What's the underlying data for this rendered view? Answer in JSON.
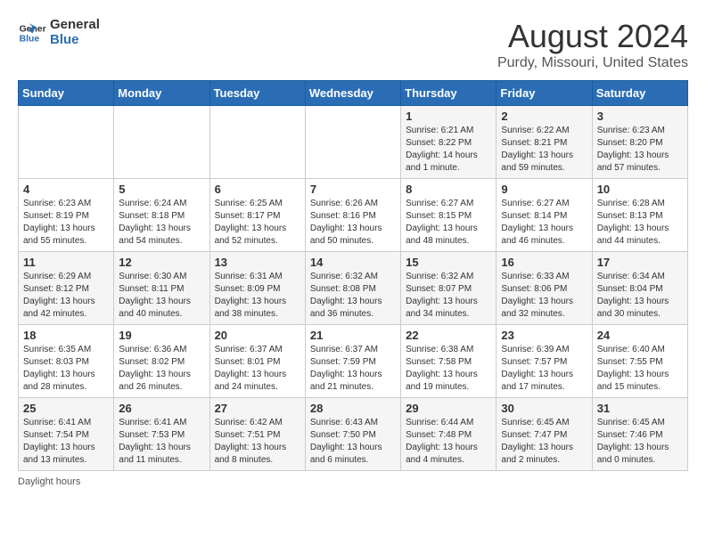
{
  "header": {
    "logo_line1": "General",
    "logo_line2": "Blue",
    "month_year": "August 2024",
    "location": "Purdy, Missouri, United States"
  },
  "days_of_week": [
    "Sunday",
    "Monday",
    "Tuesday",
    "Wednesday",
    "Thursday",
    "Friday",
    "Saturday"
  ],
  "footer": {
    "note": "Daylight hours"
  },
  "weeks": [
    [
      {
        "day": "",
        "info": ""
      },
      {
        "day": "",
        "info": ""
      },
      {
        "day": "",
        "info": ""
      },
      {
        "day": "",
        "info": ""
      },
      {
        "day": "1",
        "info": "Sunrise: 6:21 AM\nSunset: 8:22 PM\nDaylight: 14 hours\nand 1 minute."
      },
      {
        "day": "2",
        "info": "Sunrise: 6:22 AM\nSunset: 8:21 PM\nDaylight: 13 hours\nand 59 minutes."
      },
      {
        "day": "3",
        "info": "Sunrise: 6:23 AM\nSunset: 8:20 PM\nDaylight: 13 hours\nand 57 minutes."
      }
    ],
    [
      {
        "day": "4",
        "info": "Sunrise: 6:23 AM\nSunset: 8:19 PM\nDaylight: 13 hours\nand 55 minutes."
      },
      {
        "day": "5",
        "info": "Sunrise: 6:24 AM\nSunset: 8:18 PM\nDaylight: 13 hours\nand 54 minutes."
      },
      {
        "day": "6",
        "info": "Sunrise: 6:25 AM\nSunset: 8:17 PM\nDaylight: 13 hours\nand 52 minutes."
      },
      {
        "day": "7",
        "info": "Sunrise: 6:26 AM\nSunset: 8:16 PM\nDaylight: 13 hours\nand 50 minutes."
      },
      {
        "day": "8",
        "info": "Sunrise: 6:27 AM\nSunset: 8:15 PM\nDaylight: 13 hours\nand 48 minutes."
      },
      {
        "day": "9",
        "info": "Sunrise: 6:27 AM\nSunset: 8:14 PM\nDaylight: 13 hours\nand 46 minutes."
      },
      {
        "day": "10",
        "info": "Sunrise: 6:28 AM\nSunset: 8:13 PM\nDaylight: 13 hours\nand 44 minutes."
      }
    ],
    [
      {
        "day": "11",
        "info": "Sunrise: 6:29 AM\nSunset: 8:12 PM\nDaylight: 13 hours\nand 42 minutes."
      },
      {
        "day": "12",
        "info": "Sunrise: 6:30 AM\nSunset: 8:11 PM\nDaylight: 13 hours\nand 40 minutes."
      },
      {
        "day": "13",
        "info": "Sunrise: 6:31 AM\nSunset: 8:09 PM\nDaylight: 13 hours\nand 38 minutes."
      },
      {
        "day": "14",
        "info": "Sunrise: 6:32 AM\nSunset: 8:08 PM\nDaylight: 13 hours\nand 36 minutes."
      },
      {
        "day": "15",
        "info": "Sunrise: 6:32 AM\nSunset: 8:07 PM\nDaylight: 13 hours\nand 34 minutes."
      },
      {
        "day": "16",
        "info": "Sunrise: 6:33 AM\nSunset: 8:06 PM\nDaylight: 13 hours\nand 32 minutes."
      },
      {
        "day": "17",
        "info": "Sunrise: 6:34 AM\nSunset: 8:04 PM\nDaylight: 13 hours\nand 30 minutes."
      }
    ],
    [
      {
        "day": "18",
        "info": "Sunrise: 6:35 AM\nSunset: 8:03 PM\nDaylight: 13 hours\nand 28 minutes."
      },
      {
        "day": "19",
        "info": "Sunrise: 6:36 AM\nSunset: 8:02 PM\nDaylight: 13 hours\nand 26 minutes."
      },
      {
        "day": "20",
        "info": "Sunrise: 6:37 AM\nSunset: 8:01 PM\nDaylight: 13 hours\nand 24 minutes."
      },
      {
        "day": "21",
        "info": "Sunrise: 6:37 AM\nSunset: 7:59 PM\nDaylight: 13 hours\nand 21 minutes."
      },
      {
        "day": "22",
        "info": "Sunrise: 6:38 AM\nSunset: 7:58 PM\nDaylight: 13 hours\nand 19 minutes."
      },
      {
        "day": "23",
        "info": "Sunrise: 6:39 AM\nSunset: 7:57 PM\nDaylight: 13 hours\nand 17 minutes."
      },
      {
        "day": "24",
        "info": "Sunrise: 6:40 AM\nSunset: 7:55 PM\nDaylight: 13 hours\nand 15 minutes."
      }
    ],
    [
      {
        "day": "25",
        "info": "Sunrise: 6:41 AM\nSunset: 7:54 PM\nDaylight: 13 hours\nand 13 minutes."
      },
      {
        "day": "26",
        "info": "Sunrise: 6:41 AM\nSunset: 7:53 PM\nDaylight: 13 hours\nand 11 minutes."
      },
      {
        "day": "27",
        "info": "Sunrise: 6:42 AM\nSunset: 7:51 PM\nDaylight: 13 hours\nand 8 minutes."
      },
      {
        "day": "28",
        "info": "Sunrise: 6:43 AM\nSunset: 7:50 PM\nDaylight: 13 hours\nand 6 minutes."
      },
      {
        "day": "29",
        "info": "Sunrise: 6:44 AM\nSunset: 7:48 PM\nDaylight: 13 hours\nand 4 minutes."
      },
      {
        "day": "30",
        "info": "Sunrise: 6:45 AM\nSunset: 7:47 PM\nDaylight: 13 hours\nand 2 minutes."
      },
      {
        "day": "31",
        "info": "Sunrise: 6:45 AM\nSunset: 7:46 PM\nDaylight: 13 hours\nand 0 minutes."
      }
    ]
  ]
}
